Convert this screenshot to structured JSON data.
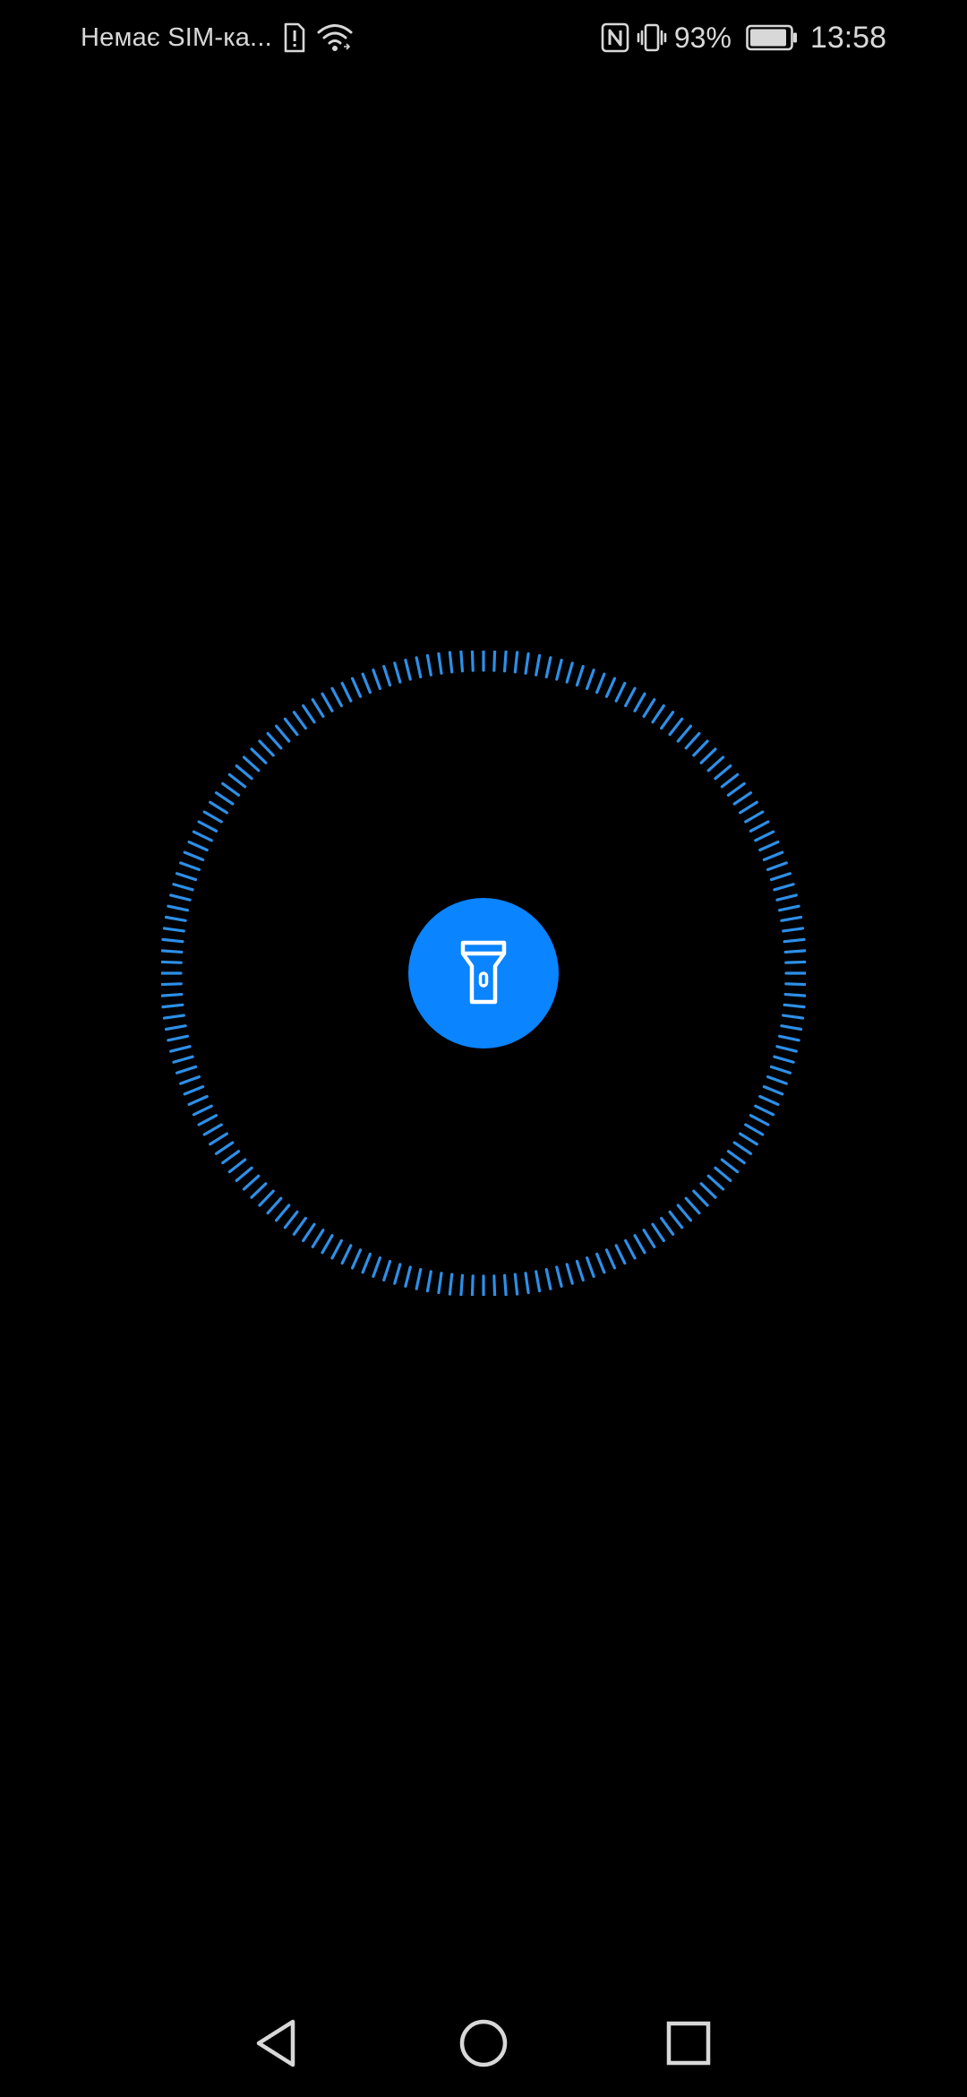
{
  "status_bar": {
    "carrier": "Немає SIM-ка...",
    "battery_percent": "93%",
    "battery_level": 0.93,
    "time": "13:58",
    "icons": [
      "sim-alert-icon",
      "wifi-icon",
      "nfc-icon",
      "vibrate-icon",
      "battery-icon"
    ]
  },
  "flashlight": {
    "icon": "flashlight-icon",
    "accent_color": "#0a84ff",
    "ring_color": "#2d8fe8"
  },
  "nav_bar": {
    "icons": [
      "back-icon",
      "home-icon",
      "recents-icon"
    ]
  }
}
